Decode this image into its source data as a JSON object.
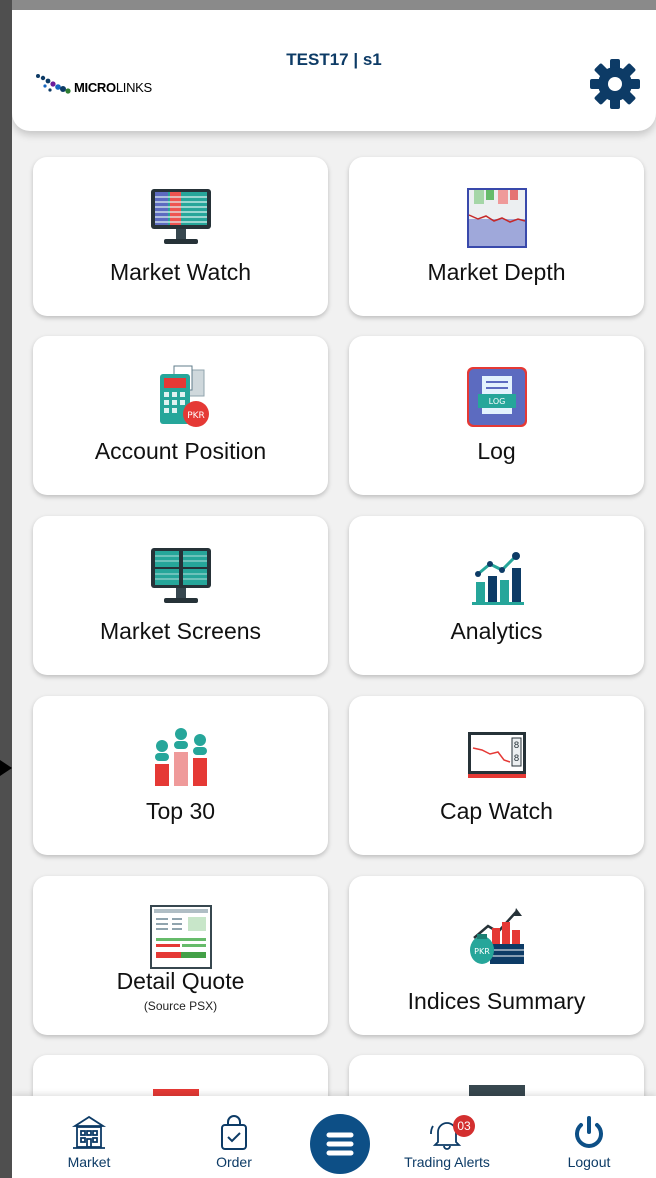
{
  "header": {
    "title": "TEST17 | s1",
    "logo_text_bold": "MICRO",
    "logo_text_rest": "LINKS"
  },
  "menu": [
    {
      "label": "Market Watch",
      "icon": "monitor-table-icon"
    },
    {
      "label": "Market Depth",
      "icon": "depth-chart-icon"
    },
    {
      "label": "Account Position",
      "icon": "calculator-pkr-icon"
    },
    {
      "label": "Log",
      "icon": "log-document-icon"
    },
    {
      "label": "Market Screens",
      "icon": "monitor-screens-icon"
    },
    {
      "label": "Analytics",
      "icon": "analytics-bar-chart-icon"
    },
    {
      "label": "Top 30",
      "icon": "people-bar-chart-icon"
    },
    {
      "label": "Cap Watch",
      "icon": "cap-watch-board-icon"
    },
    {
      "label": "Detail Quote",
      "sublabel": "(Source PSX)",
      "icon": "detail-quote-sheet-icon"
    },
    {
      "label": "Indices Summary",
      "icon": "indices-moneybag-icon"
    }
  ],
  "bottom_nav": {
    "market": "Market",
    "order": "Order",
    "trading_alerts": "Trading Alerts",
    "alerts_badge": "03",
    "logout": "Logout"
  },
  "colors": {
    "primary": "#0d3b66",
    "fab": "#0d4f86",
    "badge": "#d32f2f"
  }
}
